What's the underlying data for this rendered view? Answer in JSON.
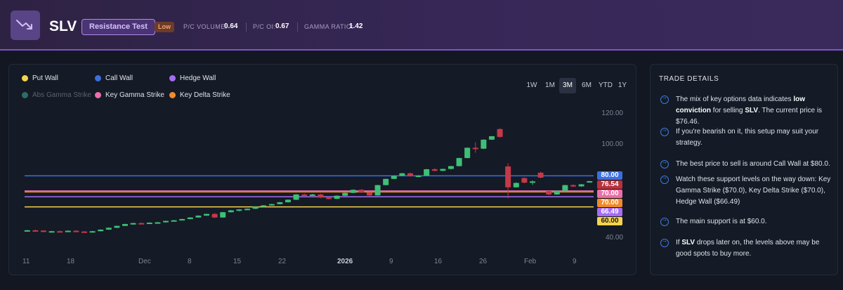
{
  "header": {
    "ticker": "SLV",
    "tag": "Resistance Test",
    "conviction": "Low",
    "pc_volume_label": "P/C VOLUME:",
    "pc_volume": "0.64",
    "pc_oi_label": "P/C OI:",
    "pc_oi": "0.67",
    "gamma_ratio_label": "GAMMA RATIO:",
    "gamma_ratio": "1.42",
    "logo_icon": "trend-down-icon"
  },
  "legend": [
    {
      "label": "Put Wall",
      "color": "#f7d44c"
    },
    {
      "label": "Call Wall",
      "color": "#3b6fe0"
    },
    {
      "label": "Hedge Wall",
      "color": "#a56df2"
    },
    {
      "label": "Abs Gamma Strike",
      "color": "#2f6b6b"
    },
    {
      "label": "Key Gamma Strike",
      "color": "#e96fa8"
    },
    {
      "label": "Key Delta Strike",
      "color": "#f08a2c"
    }
  ],
  "timeframes": [
    "1W",
    "1M",
    "3M",
    "6M",
    "YTD",
    "1Y"
  ],
  "active_timeframe": "3M",
  "chart_data": {
    "type": "candlestick",
    "y_ticks": [
      "120.00",
      "100.00",
      "40.00"
    ],
    "ylim": [
      35,
      125
    ],
    "x_ticks": [
      "11",
      "18",
      "Dec",
      "8",
      "15",
      "22",
      "2026",
      "9",
      "16",
      "26",
      "Feb",
      "9"
    ],
    "levels": [
      {
        "name": "Call Wall",
        "value": 80.0,
        "label": "80.00",
        "color": "#3b6fe0"
      },
      {
        "name": "Current",
        "value": 76.54,
        "label": "76.54",
        "color": "#b8323d"
      },
      {
        "name": "Key Delta Strike",
        "value": 70.0,
        "label": "70.00",
        "color": "#f08a2c"
      },
      {
        "name": "Key Gamma Strike",
        "value": 70.0,
        "label": "70.00",
        "color": "#e96fa8"
      },
      {
        "name": "Hedge Wall",
        "value": 66.49,
        "label": "66.49",
        "color": "#a56df2"
      },
      {
        "name": "Put Wall",
        "value": 60.0,
        "label": "60.00",
        "color": "#f7d44c"
      }
    ],
    "candles": [
      [
        44.5,
        45.2,
        44.3,
        45.0
      ],
      [
        45.0,
        45.4,
        44.6,
        44.8
      ],
      [
        44.8,
        45.0,
        43.8,
        44.1
      ],
      [
        44.1,
        44.6,
        43.7,
        44.4
      ],
      [
        44.4,
        44.8,
        43.9,
        44.0
      ],
      [
        44.0,
        44.9,
        43.8,
        44.7
      ],
      [
        44.7,
        45.0,
        44.0,
        44.2
      ],
      [
        44.2,
        44.5,
        43.5,
        43.8
      ],
      [
        43.8,
        44.6,
        43.6,
        44.4
      ],
      [
        44.4,
        45.6,
        44.2,
        45.4
      ],
      [
        45.4,
        46.8,
        45.2,
        46.6
      ],
      [
        46.6,
        48.0,
        46.4,
        47.8
      ],
      [
        47.8,
        49.2,
        47.6,
        49.0
      ],
      [
        49.0,
        49.8,
        48.6,
        49.6
      ],
      [
        49.6,
        50.0,
        49.0,
        49.3
      ],
      [
        49.3,
        50.1,
        49.0,
        49.9
      ],
      [
        49.9,
        50.4,
        49.4,
        50.1
      ],
      [
        50.1,
        51.2,
        49.9,
        51.0
      ],
      [
        51.0,
        51.6,
        50.6,
        51.4
      ],
      [
        51.4,
        52.4,
        51.2,
        52.2
      ],
      [
        52.2,
        53.4,
        52.0,
        53.2
      ],
      [
        53.2,
        54.6,
        53.0,
        54.4
      ],
      [
        54.4,
        55.6,
        54.2,
        55.5
      ],
      [
        55.5,
        56.0,
        52.8,
        53.2
      ],
      [
        53.2,
        56.8,
        53.0,
        56.6
      ],
      [
        56.6,
        58.0,
        56.4,
        57.8
      ],
      [
        57.8,
        58.6,
        57.2,
        58.4
      ],
      [
        58.4,
        59.0,
        57.9,
        58.8
      ],
      [
        58.8,
        60.4,
        58.6,
        60.2
      ],
      [
        60.2,
        61.2,
        60.0,
        61.0
      ],
      [
        61.0,
        62.0,
        60.8,
        61.8
      ],
      [
        61.8,
        63.2,
        61.6,
        63.0
      ],
      [
        63.0,
        64.8,
        62.8,
        64.6
      ],
      [
        64.6,
        68.2,
        64.4,
        68.0
      ],
      [
        68.0,
        68.6,
        67.0,
        67.6
      ],
      [
        67.6,
        68.4,
        67.0,
        68.0
      ],
      [
        68.0,
        68.5,
        65.6,
        66.0
      ],
      [
        66.0,
        66.4,
        64.8,
        65.2
      ],
      [
        65.2,
        67.4,
        65.0,
        67.2
      ],
      [
        67.2,
        69.2,
        67.0,
        69.0
      ],
      [
        69.0,
        71.2,
        68.8,
        71.0
      ],
      [
        71.0,
        71.4,
        68.9,
        69.4
      ],
      [
        69.4,
        69.8,
        67.0,
        67.4
      ],
      [
        67.4,
        74.2,
        67.2,
        74.0
      ],
      [
        74.0,
        78.2,
        73.8,
        78.0
      ],
      [
        78.0,
        80.2,
        77.8,
        80.0
      ],
      [
        80.0,
        81.8,
        79.8,
        81.6
      ],
      [
        81.6,
        82.0,
        79.4,
        79.8
      ],
      [
        79.8,
        80.4,
        79.0,
        80.1
      ],
      [
        80.1,
        84.4,
        80.0,
        84.2
      ],
      [
        84.2,
        85.0,
        82.8,
        83.2
      ],
      [
        83.2,
        84.6,
        83.0,
        84.4
      ],
      [
        84.4,
        86.4,
        84.0,
        86.2
      ],
      [
        86.2,
        91.6,
        86.0,
        91.4
      ],
      [
        91.4,
        98.2,
        91.2,
        98.0
      ],
      [
        98.0,
        101.6,
        94.8,
        97.4
      ],
      [
        97.4,
        103.4,
        97.2,
        103.2
      ],
      [
        103.2,
        105.6,
        103.0,
        105.4
      ],
      [
        110.0,
        110.6,
        104.4,
        105.0
      ],
      [
        86.0,
        88.0,
        65.5,
        72.6
      ],
      [
        72.6,
        75.8,
        72.4,
        75.4
      ],
      [
        78.5,
        79.0,
        75.2,
        75.6
      ],
      [
        75.6,
        77.0,
        74.2,
        76.4
      ],
      [
        82.0,
        82.6,
        78.4,
        78.8
      ],
      [
        70.2,
        70.8,
        67.4,
        68.0
      ],
      [
        68.0,
        70.6,
        67.8,
        70.4
      ],
      [
        70.4,
        74.2,
        70.2,
        74.0
      ],
      [
        74.0,
        74.5,
        72.8,
        73.2
      ],
      [
        73.2,
        74.8,
        72.9,
        74.5
      ],
      [
        76.0,
        76.8,
        75.9,
        76.54
      ]
    ]
  },
  "trade_details": {
    "title": "TRADE DETAILS",
    "items": [
      {
        "parts": [
          [
            "The mix of key options data indicates ",
            false
          ],
          [
            "low conviction",
            true
          ],
          [
            " for selling ",
            false
          ],
          [
            "SLV",
            true
          ],
          [
            ". The current price is $76.46.",
            false
          ]
        ]
      },
      {
        "parts": [
          [
            "If you're bearish on it, this setup may suit your strategy.",
            false
          ]
        ]
      },
      {
        "parts": [
          [
            "The best price to sell is around Call Wall at $80.0.",
            false
          ]
        ]
      },
      {
        "parts": [
          [
            "Watch these support levels on the way down: Key Gamma Strike ($70.0), Key Delta Strike ($70.0), Hedge Wall ($66.49)",
            false
          ]
        ]
      },
      {
        "parts": [
          [
            "The main support is at $60.0.",
            false
          ]
        ]
      },
      {
        "parts": [
          [
            "If ",
            false
          ],
          [
            "SLV",
            true
          ],
          [
            " drops later on, the levels above may be good spots to buy more.",
            false
          ]
        ]
      }
    ]
  }
}
